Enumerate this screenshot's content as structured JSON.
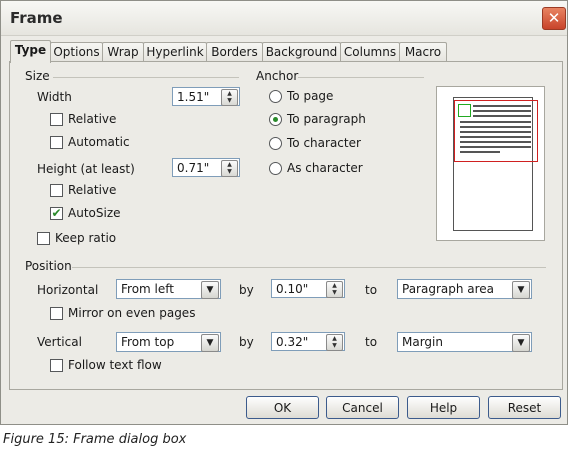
{
  "window": {
    "title": "Frame",
    "close_glyph": "✕"
  },
  "tabs": [
    {
      "label": "Type",
      "active": true
    },
    {
      "label": "Options"
    },
    {
      "label": "Wrap"
    },
    {
      "label": "Hyperlink"
    },
    {
      "label": "Borders"
    },
    {
      "label": "Background"
    },
    {
      "label": "Columns"
    },
    {
      "label": "Macro"
    }
  ],
  "size": {
    "heading": "Size",
    "width_label": "Width",
    "width_value": "1.51\"",
    "width_relative": "Relative",
    "width_automatic": "Automatic",
    "height_label": "Height (at least)",
    "height_value": "0.71\"",
    "height_relative": "Relative",
    "autosize": "AutoSize",
    "autosize_checked": true,
    "keep_ratio": "Keep ratio"
  },
  "anchor": {
    "heading": "Anchor",
    "options": [
      "To page",
      "To paragraph",
      "To character",
      "As character"
    ],
    "selected": "To paragraph"
  },
  "position": {
    "heading": "Position",
    "horizontal_label": "Horizontal",
    "horizontal_value": "From left",
    "h_by_label": "by",
    "h_by_value": "0.10\"",
    "h_to_label": "to",
    "h_to_value": "Paragraph area",
    "mirror": "Mirror on even pages",
    "vertical_label": "Vertical",
    "vertical_value": "From top",
    "v_by_label": "by",
    "v_by_value": "0.32\"",
    "v_to_label": "to",
    "v_to_value": "Margin",
    "follow": "Follow text flow"
  },
  "buttons": {
    "ok": "OK",
    "cancel": "Cancel",
    "help": "Help",
    "reset": "Reset"
  },
  "caption": "Figure 15: Frame dialog box",
  "colors": {
    "accent_check": "#2a8a2a",
    "preview_frame": "#d02020",
    "preview_inner": "#22aa22"
  }
}
